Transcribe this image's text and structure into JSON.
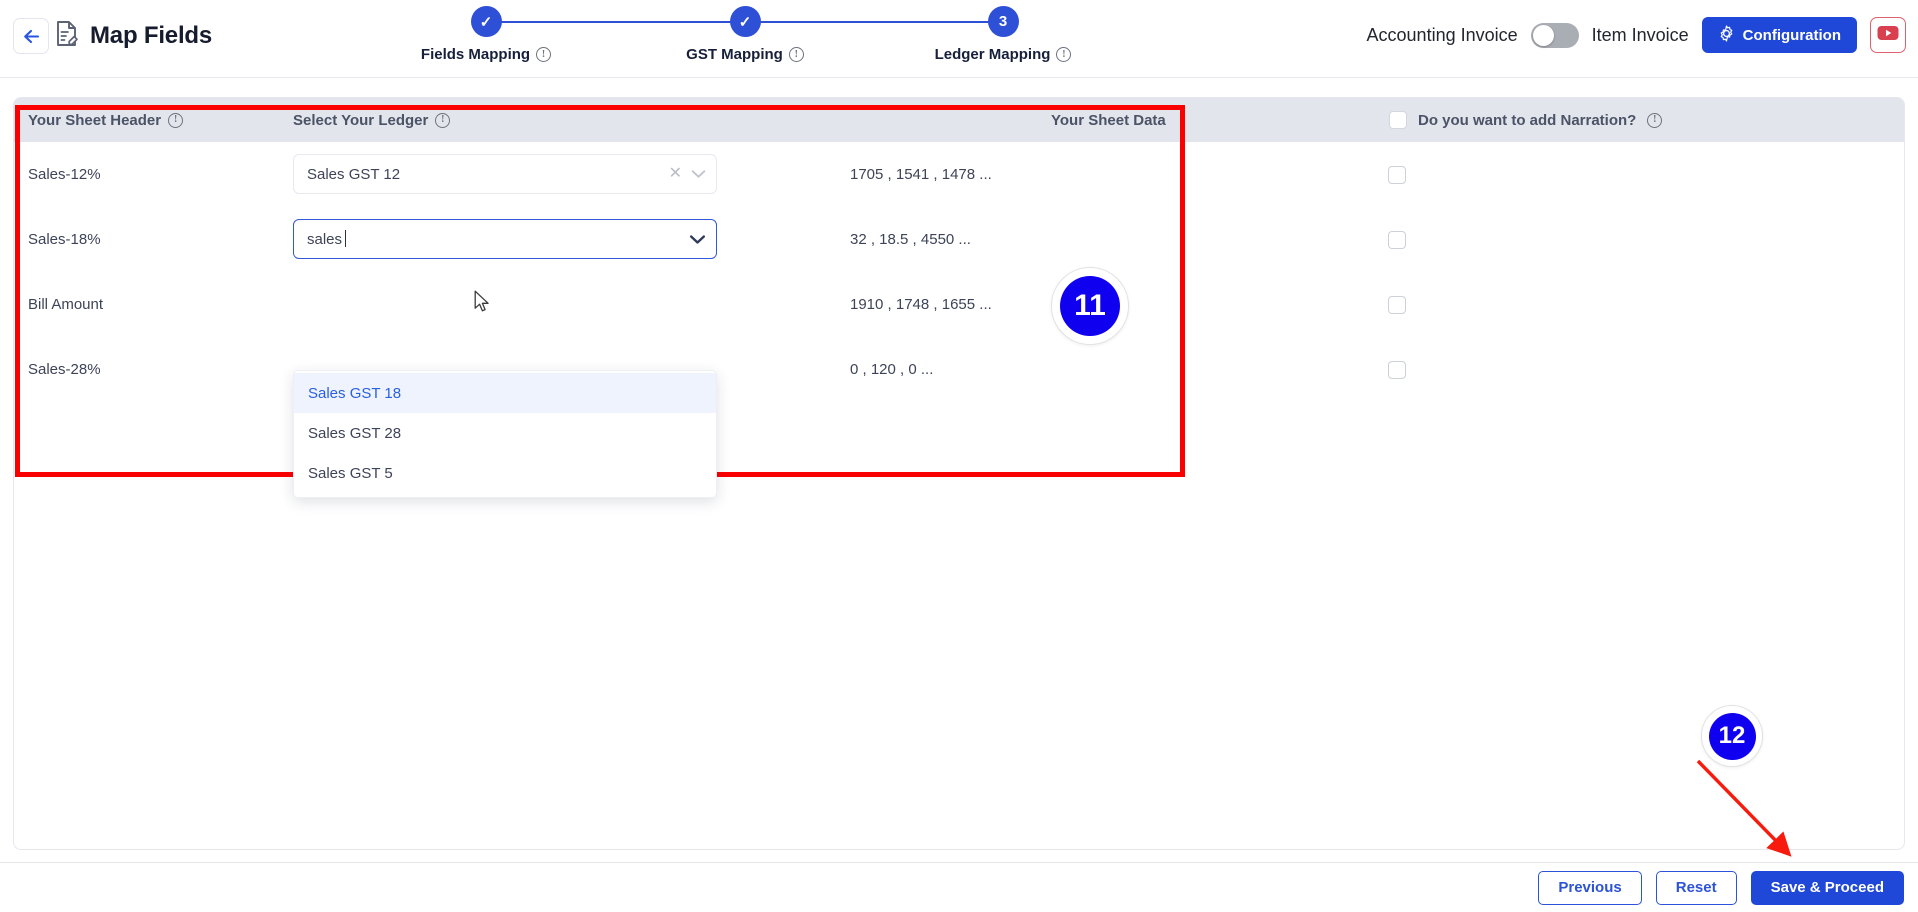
{
  "header": {
    "back_icon": "arrow-left-icon",
    "doc_icon": "document-edit-icon",
    "title": "Map Fields"
  },
  "stepper": {
    "steps": [
      {
        "id": "fields-mapping",
        "marker": "✓",
        "label": "Fields Mapping",
        "state": "completed",
        "info_icon": "info-icon"
      },
      {
        "id": "gst-mapping",
        "marker": "✓",
        "label": "GST Mapping",
        "state": "completed",
        "info_icon": "info-icon"
      },
      {
        "id": "ledger-mapping",
        "marker": "3",
        "label": "Ledger Mapping",
        "state": "current",
        "info_icon": "info-icon"
      }
    ],
    "accent_color": "#2d50d6"
  },
  "topright": {
    "accounting_invoice_label": "Accounting Invoice",
    "item_invoice_label": "Item Invoice",
    "toggle_state": "off",
    "toggle_off_color": "#a9aeb4",
    "configuration_label": "Configuration",
    "configuration_icon": "gear-icon",
    "configuration_color": "#2048d8",
    "youtube_icon": "youtube-icon",
    "youtube_color": "#d8404f"
  },
  "table": {
    "columns": {
      "sheet_header": "Your Sheet Header",
      "select_ledger": "Select Your Ledger",
      "sheet_data": "Your Sheet Data",
      "narration": "Do you want to add Narration?"
    },
    "header_info_icon": "info-icon",
    "header_bg": "#e2e5eb",
    "rows": [
      {
        "sheet_header": "Sales-12%",
        "ledger_value": "Sales GST 12",
        "ledger_state": "selected",
        "clear_icon": "close-icon",
        "caret_icon": "chevron-down-icon",
        "sheet_data": "1705 , 1541 , 1478 ...",
        "narration_checked": false
      },
      {
        "sheet_header": "Sales-18%",
        "ledger_value": "sales",
        "ledger_state": "typing",
        "caret_icon": "chevron-down-icon",
        "sheet_data": "32 , 18.5 , 4550 ...",
        "narration_checked": false
      },
      {
        "sheet_header": "Bill Amount",
        "ledger_value": "",
        "ledger_state": "hidden",
        "sheet_data": "1910 , 1748 , 1655 ...",
        "narration_checked": false
      },
      {
        "sheet_header": "Sales-28%",
        "ledger_value": "",
        "ledger_state": "hidden",
        "sheet_data": "0 , 120 , 0 ...",
        "narration_checked": false
      }
    ]
  },
  "dropdown": {
    "options": [
      {
        "label": "Sales GST 18",
        "highlighted": true
      },
      {
        "label": "Sales GST 28",
        "highlighted": false
      },
      {
        "label": "Sales GST 5",
        "highlighted": false
      }
    ],
    "highlight_bg": "#eef3fe",
    "highlight_text": "#2a5fe0"
  },
  "annotations": {
    "highlight_box_color": "#fb0000",
    "badges": [
      {
        "id": "badge-11",
        "text": "11",
        "color": "#1000f0"
      },
      {
        "id": "badge-12",
        "text": "12",
        "color": "#1000f0"
      }
    ],
    "arrow_color": "#f71b0e"
  },
  "footer": {
    "previous_label": "Previous",
    "reset_label": "Reset",
    "save_label": "Save & Proceed",
    "primary_color": "#2048d8"
  }
}
